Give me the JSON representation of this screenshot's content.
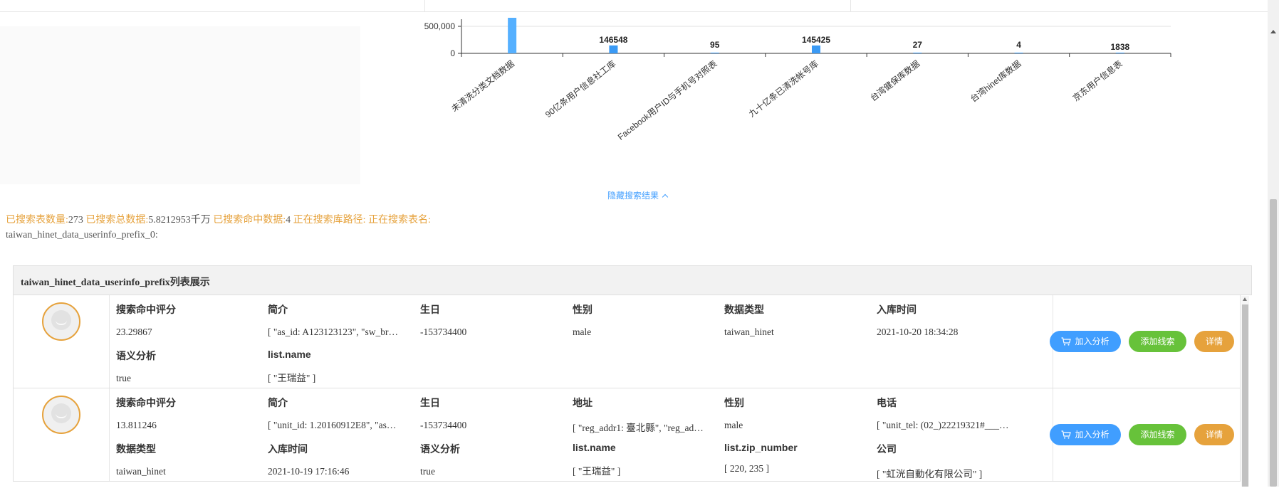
{
  "hide_results_label": "隐藏搜索结果",
  "status": {
    "searched_tables_label": "已搜索表数量:",
    "searched_tables_value": "273",
    "searched_total_label": "已搜索总数据:",
    "searched_total_value": "5.8212953千万",
    "hit_label": "已搜索命中数据:",
    "hit_value": "4",
    "path_label": "正在搜索库路径:",
    "table_label": "正在搜索表名:",
    "table_value": "taiwan_hinet_data_userinfo_prefix_0:"
  },
  "chart_data": {
    "type": "bar",
    "categories": [
      "未清洗分类文档数据",
      "90亿条用户信息社工库",
      "Facebook用户ID与手机号对照表",
      "九十亿条已清洗帐号库",
      "台湾健保库数据",
      "台湾hinet库数据",
      "京东用户信息表"
    ],
    "values": [
      null,
      146548,
      95,
      145425,
      27,
      4,
      1838
    ],
    "data_labels": [
      "",
      "146548",
      "95",
      "145425",
      "27",
      "4",
      "1838"
    ],
    "y_ticks": [
      "0",
      "500,000"
    ],
    "ylim": [
      0,
      500000
    ],
    "bar_color": "#3a9af5",
    "first_bar_color": "#55b0ff"
  },
  "list": {
    "title": "taiwan_hinet_data_userinfo_prefix列表展示",
    "buttons": {
      "analyze": "加入分析",
      "clue": "添加线索",
      "detail": "详情"
    },
    "rows": [
      {
        "fields": [
          {
            "key": "搜索命中评分",
            "value": "23.29867"
          },
          {
            "key": "简介",
            "value": "[ \"as_id: A123123123\", \"sw_br…"
          },
          {
            "key": "生日",
            "value": "-153734400"
          },
          {
            "key": "性别",
            "value": "male"
          },
          {
            "key": "数据类型",
            "value": "taiwan_hinet"
          },
          {
            "key": "入库时间",
            "value": "2021-10-20 18:34:28"
          },
          {
            "key": "语义分析",
            "value": "true"
          },
          {
            "key": "list.name",
            "value": "[ \"王瑞益\" ]"
          }
        ]
      },
      {
        "fields": [
          {
            "key": "搜索命中评分",
            "value": "13.811246"
          },
          {
            "key": "简介",
            "value": "[ \"unit_id: 1.20160912E8\", \"as…"
          },
          {
            "key": "生日",
            "value": "-153734400"
          },
          {
            "key": "地址",
            "value": "[ \"reg_addr1: 臺北縣\", \"reg_ad…"
          },
          {
            "key": "性别",
            "value": "male"
          },
          {
            "key": "电话",
            "value": "[ \"unit_tel: (02_)22219321#___…"
          },
          {
            "key": "数据类型",
            "value": "taiwan_hinet"
          },
          {
            "key": "入库时间",
            "value": "2021-10-19 17:16:46"
          },
          {
            "key": "语义分析",
            "value": "true"
          },
          {
            "key": "list.name",
            "value": "[ \"王瑞益\" ]"
          },
          {
            "key": "list.zip_number",
            "value": "[ 220, 235 ]"
          },
          {
            "key": "公司",
            "value": "[ \"虹洸自動化有限公司\" ]"
          }
        ]
      }
    ]
  }
}
